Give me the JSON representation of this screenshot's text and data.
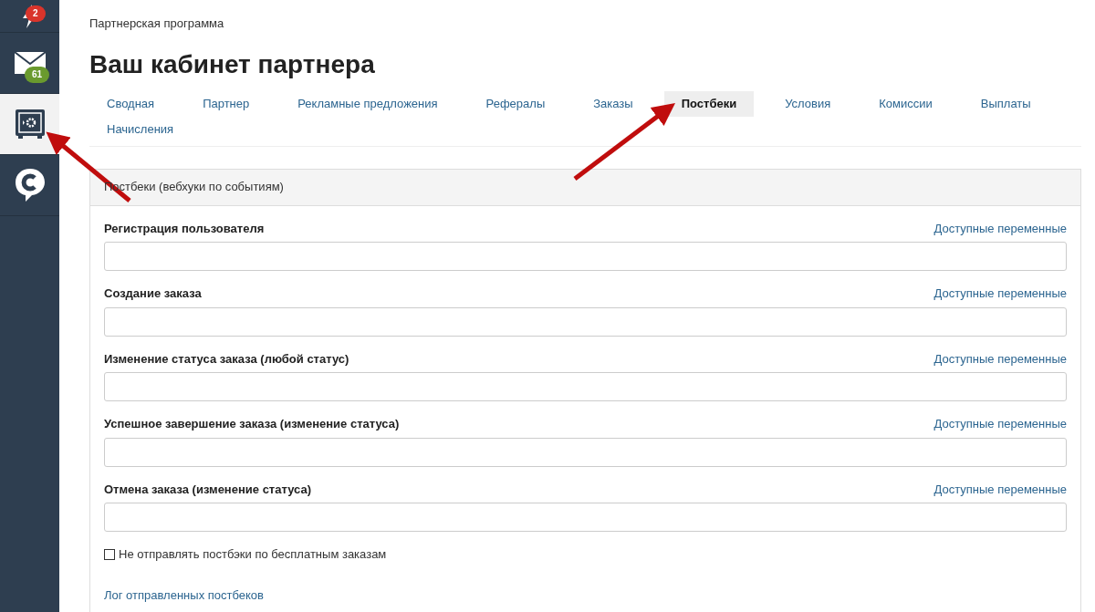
{
  "sidebar": {
    "items": [
      {
        "kind": "lightning",
        "badge": "2",
        "color": "#d9342b",
        "selected": false
      },
      {
        "kind": "mail",
        "badge": "61",
        "color": "#6a9a2e",
        "selected": false
      },
      {
        "kind": "safe",
        "selected": true
      },
      {
        "kind": "chat",
        "selected": false
      }
    ]
  },
  "breadcrumb": "Партнерская программа",
  "title": "Ваш кабинет партнера",
  "tabs": [
    {
      "label": "Сводная",
      "selected": false
    },
    {
      "label": "Партнер",
      "selected": false
    },
    {
      "label": "Рекламные предложения",
      "selected": false
    },
    {
      "label": "Рефералы",
      "selected": false
    },
    {
      "label": "Заказы",
      "selected": false
    },
    {
      "label": "Постбеки",
      "selected": true
    },
    {
      "label": "Условия",
      "selected": false
    },
    {
      "label": "Комиссии",
      "selected": false
    },
    {
      "label": "Выплаты",
      "selected": false
    },
    {
      "label": "Начисления",
      "selected": false
    }
  ],
  "panel": {
    "title": "Постбеки (вебхуки по событиям)",
    "fields": [
      {
        "label": "Регистрация пользователя",
        "link": "Доступные переменные"
      },
      {
        "label": "Создание заказа",
        "link": "Доступные переменные"
      },
      {
        "label": "Изменение статуса заказа (любой статус)",
        "link": "Доступные переменные"
      },
      {
        "label": "Успешное завершение заказа (изменение статуса)",
        "link": "Доступные переменные"
      },
      {
        "label": "Отмена заказа (изменение статуса)",
        "link": "Доступные переменные"
      }
    ],
    "checkbox": {
      "label": "Не отправлять постбэки по бесплатным заказам",
      "checked": false
    },
    "log_link": "Лог отправленных постбеков"
  }
}
